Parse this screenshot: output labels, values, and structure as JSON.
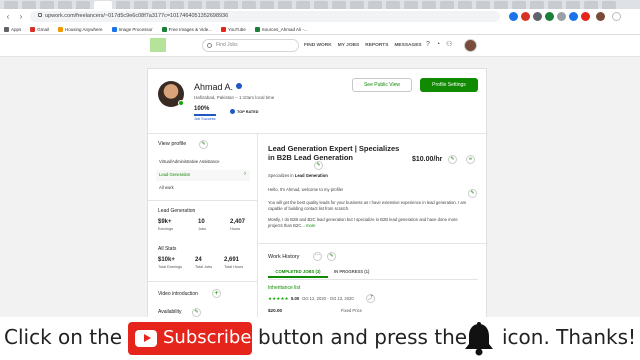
{
  "browser": {
    "url": "upwork.com/freelancers/~017d5c9e6c08f7a3177c=1017464051352698936",
    "bookmarks": [
      {
        "label": "Apps",
        "color": "#5f6368"
      },
      {
        "label": "Gmail",
        "color": "#d93025"
      },
      {
        "label": "Housing Anywhere",
        "color": "#f29900"
      },
      {
        "label": "Image Processor",
        "color": "#1a73e8"
      },
      {
        "label": "Free Images & Vide...",
        "color": "#188038"
      },
      {
        "label": "YouTube",
        "color": "#e5251b"
      },
      {
        "label": "Sources_Ahmad Ali -...",
        "color": "#188038"
      }
    ]
  },
  "upwork_header": {
    "search_placeholder": "Find Jobs",
    "nav": [
      "FIND WORK",
      "MY JOBS",
      "REPORTS",
      "MESSAGES"
    ],
    "icons": [
      "help-icon",
      "notifications-icon",
      "team-icon",
      "avatar"
    ]
  },
  "profile": {
    "name": "Ahmad A.",
    "location": "Hafizabad, Pakistan – 1:10am local time",
    "job_success_pct": "100%",
    "job_success_value": 1.0,
    "job_success_label": "Job Success",
    "top_rated": "TOP RATED",
    "public_view_label": "See Public View",
    "settings_label": "Profile Settings"
  },
  "left": {
    "view_profile": "View profile",
    "profile_items": [
      "Virtual/Administrative Assistance",
      "Lead Generation",
      "All work"
    ],
    "lead_gen_title": "Lead Generation",
    "lead_gen_stats": [
      {
        "value": "$9k+",
        "label": "Earnings"
      },
      {
        "value": "10",
        "label": "Jobs"
      },
      {
        "value": "2,407",
        "label": "Hours"
      }
    ],
    "all_stats_title": "All Stats",
    "all_stats": [
      {
        "value": "$10k+",
        "label": "Total Earnings"
      },
      {
        "value": "24",
        "label": "Total Jobs"
      },
      {
        "value": "2,691",
        "label": "Total Hours"
      }
    ],
    "video_intro": "Video introduction",
    "availability": "Availability"
  },
  "right": {
    "job_title": "Lead Generation Expert | Specializes in B2B Lead Generation",
    "rate": "$10.00/hr",
    "specializes_prefix": "Specializes in",
    "specializes_value": "Lead Generation",
    "para1": "Hello, It's Ahmad, welcome to my profile!",
    "para2": "You will get the best quality leads for your business as I have extensive experience in lead generation. I am capable of building contact list from scratch.",
    "para3": "Mostly, I do B2B and B2C lead generation but I specialize in B2B lead generation and have done more projects than B2C...",
    "more": "more",
    "work_history": "Work History",
    "tab_completed": "COMPLETED JOBS (3)",
    "tab_inprogress": "IN PROGRESS (1)",
    "job_name": "Inheritance list",
    "job_stars": "★★★★★",
    "job_rating": "5.00",
    "job_dates": "Oct 12, 2020 - Oct 13, 2020",
    "job_price": "$20.00",
    "job_price_type": "Fixed Price"
  },
  "banner": {
    "part1": "Click on the",
    "subscribe": "Subscribe",
    "part2": "button and press the",
    "part3": "icon. Thanks!"
  }
}
